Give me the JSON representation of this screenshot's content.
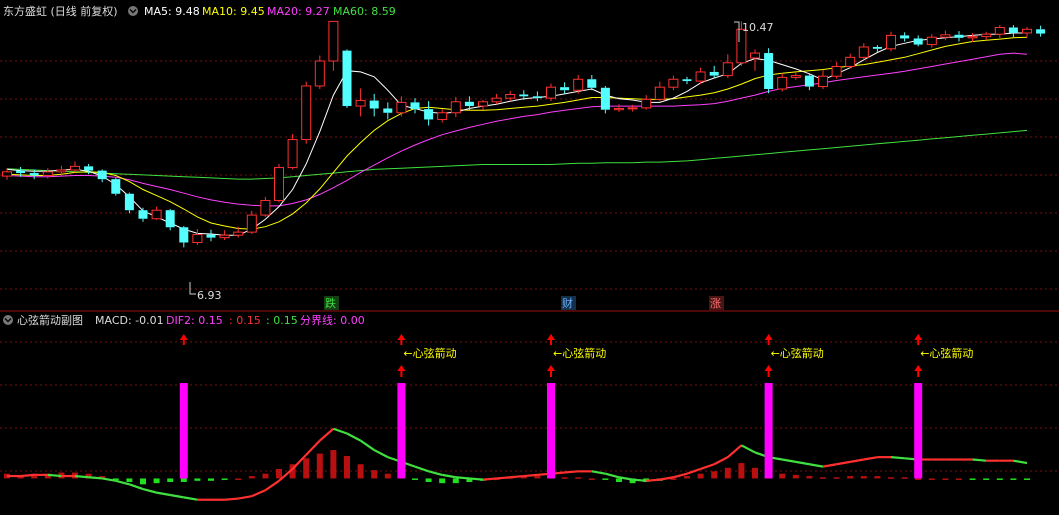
{
  "main_panel": {
    "title": "东方盛虹 (日线 前复权)",
    "ma_labels": [
      {
        "text": "MA5: 9.48",
        "color": "#ffffff"
      },
      {
        "text": "MA10: 9.45",
        "color": "#ffff00"
      },
      {
        "text": "MA20: 9.27",
        "color": "#ff40ff"
      },
      {
        "text": "MA60: 8.59",
        "color": "#40e040"
      }
    ],
    "high_label": "10.47",
    "low_label": "6.93",
    "event_tags": [
      {
        "text": "跌",
        "color": "#40e040",
        "bg": "#154015"
      },
      {
        "text": "财",
        "color": "#6ab0ff",
        "bg": "#15304a"
      },
      {
        "text": "涨",
        "color": "#ff7070",
        "bg": "#4a1515"
      }
    ]
  },
  "sub_panel": {
    "title": "心弦箭动副图",
    "labels": [
      {
        "text": "MACD: -0.01",
        "color": "#dddddd"
      },
      {
        "text": "DIF2: 0.15",
        "color": "#ff40ff"
      },
      {
        "text": ": 0.15",
        "color": "#ff3030"
      },
      {
        "text": ": 0.15",
        "color": "#40e040"
      },
      {
        "text": "分界线: 0.00",
        "color": "#ff40ff"
      }
    ],
    "signal_text": "←心弦箭动"
  },
  "colors": {
    "up": "#ff3030",
    "down": "#54ffff",
    "ma5": "#ffffff",
    "ma10": "#ffff00",
    "ma20": "#ff40ff",
    "ma60": "#40e040",
    "signal_bar": "#ff00ff",
    "arrow": "#ff0000",
    "signal_text": "#ffff00",
    "grid": "#7a1010"
  },
  "chart_data": {
    "type": "candlestick",
    "y_range": [
      6.4,
      10.8
    ],
    "candles": [
      [
        8.27,
        8.34,
        8.4,
        8.21
      ],
      [
        8.36,
        8.32,
        8.42,
        8.26
      ],
      [
        8.32,
        8.28,
        8.38,
        8.22
      ],
      [
        8.28,
        8.34,
        8.4,
        8.23
      ],
      [
        8.34,
        8.37,
        8.44,
        8.28
      ],
      [
        8.37,
        8.43,
        8.51,
        8.33
      ],
      [
        8.43,
        8.36,
        8.47,
        8.3
      ],
      [
        8.36,
        8.22,
        8.38,
        8.17
      ],
      [
        8.22,
        7.98,
        8.24,
        7.95
      ],
      [
        7.98,
        7.71,
        8.0,
        7.66
      ],
      [
        7.71,
        7.57,
        7.75,
        7.52
      ],
      [
        7.57,
        7.71,
        7.77,
        7.55
      ],
      [
        7.71,
        7.43,
        7.73,
        7.38
      ],
      [
        7.43,
        7.18,
        7.45,
        7.1
      ],
      [
        7.18,
        7.31,
        7.4,
        7.14
      ],
      [
        7.31,
        7.26,
        7.39,
        7.2
      ],
      [
        7.26,
        7.3,
        7.38,
        7.22
      ],
      [
        7.3,
        7.35,
        7.44,
        7.26
      ],
      [
        7.35,
        7.63,
        7.7,
        7.32
      ],
      [
        7.63,
        7.87,
        7.93,
        7.6
      ],
      [
        7.87,
        8.41,
        8.47,
        7.84
      ],
      [
        8.41,
        8.87,
        8.96,
        8.38
      ],
      [
        8.87,
        9.75,
        9.82,
        8.8
      ],
      [
        9.75,
        10.16,
        10.25,
        9.7
      ],
      [
        10.16,
        10.81,
        10.81,
        10.0
      ],
      [
        10.33,
        9.42,
        10.35,
        9.39
      ],
      [
        9.42,
        9.51,
        9.71,
        9.25
      ],
      [
        9.51,
        9.38,
        9.62,
        9.25
      ],
      [
        9.38,
        9.31,
        9.48,
        9.2
      ],
      [
        9.31,
        9.48,
        9.58,
        9.25
      ],
      [
        9.48,
        9.37,
        9.55,
        9.3
      ],
      [
        9.37,
        9.2,
        9.5,
        9.1
      ],
      [
        9.2,
        9.31,
        9.37,
        9.15
      ],
      [
        9.31,
        9.49,
        9.57,
        9.24
      ],
      [
        9.49,
        9.42,
        9.58,
        9.35
      ],
      [
        9.42,
        9.49,
        9.52,
        9.36
      ],
      [
        9.49,
        9.55,
        9.62,
        9.45
      ],
      [
        9.55,
        9.61,
        9.67,
        9.5
      ],
      [
        9.61,
        9.58,
        9.68,
        9.52
      ],
      [
        9.58,
        9.55,
        9.66,
        9.5
      ],
      [
        9.55,
        9.73,
        9.79,
        9.5
      ],
      [
        9.73,
        9.68,
        9.81,
        9.62
      ],
      [
        9.68,
        9.86,
        9.93,
        9.62
      ],
      [
        9.86,
        9.72,
        9.93,
        9.68
      ],
      [
        9.72,
        9.36,
        9.75,
        9.3
      ],
      [
        9.36,
        9.38,
        9.45,
        9.32
      ],
      [
        9.38,
        9.39,
        9.44,
        9.33
      ],
      [
        9.39,
        9.53,
        9.6,
        9.36
      ],
      [
        9.53,
        9.73,
        9.82,
        9.5
      ],
      [
        9.73,
        9.86,
        9.92,
        9.68
      ],
      [
        9.86,
        9.83,
        9.9,
        9.78
      ],
      [
        9.83,
        9.98,
        10.05,
        9.78
      ],
      [
        9.98,
        9.92,
        10.08,
        9.88
      ],
      [
        9.92,
        10.13,
        10.27,
        9.88
      ],
      [
        10.13,
        10.68,
        10.81,
        10.08
      ],
      [
        10.21,
        10.29,
        10.35,
        10.0
      ],
      [
        10.29,
        9.7,
        10.37,
        9.63
      ],
      [
        9.7,
        9.89,
        9.96,
        9.66
      ],
      [
        9.89,
        9.92,
        9.98,
        9.85
      ],
      [
        9.92,
        9.74,
        9.96,
        9.68
      ],
      [
        9.74,
        9.91,
        10.01,
        9.7
      ],
      [
        9.91,
        10.07,
        10.14,
        9.87
      ],
      [
        10.07,
        10.22,
        10.28,
        10.04
      ],
      [
        10.22,
        10.39,
        10.45,
        10.18
      ],
      [
        10.39,
        10.36,
        10.42,
        10.3
      ],
      [
        10.36,
        10.58,
        10.64,
        10.32
      ],
      [
        10.58,
        10.53,
        10.63,
        10.48
      ],
      [
        10.53,
        10.43,
        10.58,
        10.4
      ],
      [
        10.43,
        10.55,
        10.6,
        10.38
      ],
      [
        10.55,
        10.59,
        10.66,
        10.5
      ],
      [
        10.59,
        10.54,
        10.65,
        10.48
      ],
      [
        10.54,
        10.56,
        10.62,
        10.47
      ],
      [
        10.56,
        10.6,
        10.64,
        10.5
      ],
      [
        10.6,
        10.71,
        10.75,
        10.54
      ],
      [
        10.71,
        10.62,
        10.75,
        10.55
      ],
      [
        10.62,
        10.68,
        10.72,
        10.55
      ],
      [
        10.68,
        10.61,
        10.74,
        10.56
      ]
    ],
    "ma5": [
      8.38,
      8.36,
      8.35,
      8.35,
      8.37,
      8.38,
      8.35,
      8.27,
      8.13,
      7.93,
      7.7,
      7.6,
      7.5,
      7.4,
      7.33,
      7.32,
      7.3,
      7.3,
      7.4,
      7.56,
      7.77,
      8.05,
      8.47,
      9.0,
      9.6,
      10.0,
      9.98,
      9.9,
      9.68,
      9.43,
      9.38,
      9.32,
      9.3,
      9.32,
      9.38,
      9.42,
      9.45,
      9.5,
      9.54,
      9.56,
      9.58,
      9.62,
      9.66,
      9.7,
      9.6,
      9.54,
      9.52,
      9.48,
      9.48,
      9.55,
      9.66,
      9.8,
      9.88,
      9.95,
      10.12,
      10.2,
      10.17,
      10.1,
      10.03,
      9.95,
      9.85,
      9.95,
      10.05,
      10.18,
      10.3,
      10.4,
      10.45,
      10.5,
      10.52,
      10.54,
      10.56,
      10.58,
      10.6,
      10.6,
      10.62,
      10.62
    ],
    "ma10": [
      8.3,
      8.29,
      8.28,
      8.28,
      8.3,
      8.33,
      8.34,
      8.33,
      8.28,
      8.18,
      8.05,
      7.95,
      7.85,
      7.73,
      7.6,
      7.5,
      7.45,
      7.41,
      7.4,
      7.44,
      7.52,
      7.65,
      7.83,
      8.06,
      8.33,
      8.6,
      8.82,
      9.02,
      9.18,
      9.3,
      9.38,
      9.4,
      9.38,
      9.36,
      9.35,
      9.35,
      9.36,
      9.38,
      9.4,
      9.42,
      9.45,
      9.48,
      9.52,
      9.56,
      9.56,
      9.55,
      9.54,
      9.53,
      9.53,
      9.54,
      9.57,
      9.6,
      9.64,
      9.7,
      9.78,
      9.87,
      9.93,
      9.96,
      9.98,
      10.0,
      10.02,
      10.05,
      10.08,
      10.1,
      10.14,
      10.18,
      10.22,
      10.28,
      10.34,
      10.4,
      10.44,
      10.48,
      10.5,
      10.52,
      10.54,
      10.55
    ],
    "ma20": [
      8.28,
      8.27,
      8.26,
      8.26,
      8.27,
      8.28,
      8.28,
      8.27,
      8.25,
      8.21,
      8.15,
      8.1,
      8.05,
      7.99,
      7.93,
      7.88,
      7.84,
      7.81,
      7.79,
      7.78,
      7.78,
      7.82,
      7.88,
      7.97,
      8.08,
      8.2,
      8.33,
      8.45,
      8.57,
      8.68,
      8.78,
      8.87,
      8.95,
      9.01,
      9.07,
      9.12,
      9.17,
      9.21,
      9.25,
      9.28,
      9.32,
      9.35,
      9.38,
      9.41,
      9.42,
      9.42,
      9.42,
      9.42,
      9.42,
      9.42,
      9.43,
      9.44,
      9.46,
      9.5,
      9.55,
      9.6,
      9.66,
      9.71,
      9.74,
      9.77,
      9.8,
      9.84,
      9.87,
      9.9,
      9.93,
      9.96,
      9.99,
      10.03,
      10.07,
      10.11,
      10.15,
      10.19,
      10.23,
      10.27,
      10.29,
      10.27
    ],
    "ma60": [
      8.39,
      8.38,
      8.37,
      8.36,
      8.35,
      8.34,
      8.33,
      8.32,
      8.31,
      8.3,
      8.29,
      8.28,
      8.27,
      8.26,
      8.25,
      8.24,
      8.23,
      8.22,
      8.22,
      8.23,
      8.24,
      8.26,
      8.28,
      8.3,
      8.32,
      8.34,
      8.36,
      8.38,
      8.39,
      8.4,
      8.41,
      8.42,
      8.43,
      8.44,
      8.45,
      8.46,
      8.46,
      8.46,
      8.46,
      8.46,
      8.46,
      8.47,
      8.48,
      8.48,
      8.49,
      8.49,
      8.49,
      8.5,
      8.5,
      8.51,
      8.52,
      8.54,
      8.56,
      8.58,
      8.6,
      8.62,
      8.64,
      8.66,
      8.68,
      8.7,
      8.72,
      8.74,
      8.76,
      8.78,
      8.8,
      8.82,
      8.84,
      8.86,
      8.88,
      8.9,
      8.92,
      8.94,
      8.96,
      8.98,
      9.0,
      9.02
    ],
    "dif": [
      0.02,
      0.02,
      0.03,
      0.03,
      0.02,
      0.02,
      0.01,
      0.0,
      -0.02,
      -0.05,
      -0.09,
      -0.12,
      -0.14,
      -0.16,
      -0.18,
      -0.18,
      -0.18,
      -0.17,
      -0.15,
      -0.1,
      -0.02,
      0.08,
      0.2,
      0.32,
      0.42,
      0.38,
      0.32,
      0.24,
      0.18,
      0.14,
      0.1,
      0.06,
      0.03,
      0.01,
      0.0,
      -0.01,
      0.0,
      0.01,
      0.02,
      0.03,
      0.04,
      0.05,
      0.06,
      0.06,
      0.04,
      0.01,
      -0.01,
      -0.02,
      -0.01,
      0.01,
      0.04,
      0.08,
      0.12,
      0.18,
      0.28,
      0.22,
      0.18,
      0.16,
      0.14,
      0.12,
      0.1,
      0.12,
      0.14,
      0.16,
      0.18,
      0.18,
      0.17,
      0.16,
      0.16,
      0.16,
      0.16,
      0.16,
      0.15,
      0.15,
      0.15,
      0.13
    ],
    "macd_bars": [
      0.04,
      0.03,
      0.04,
      0.04,
      0.05,
      0.05,
      0.04,
      0.02,
      -0.01,
      -0.03,
      -0.05,
      -0.04,
      -0.03,
      -0.03,
      -0.02,
      -0.02,
      -0.01,
      0.0,
      0.02,
      0.04,
      0.08,
      0.12,
      0.17,
      0.21,
      0.24,
      0.19,
      0.12,
      0.07,
      0.04,
      0.02,
      -0.01,
      -0.03,
      -0.04,
      -0.04,
      -0.03,
      -0.02,
      0.0,
      0.01,
      0.02,
      0.02,
      0.02,
      0.01,
      0.01,
      0.0,
      -0.01,
      -0.03,
      -0.04,
      -0.03,
      -0.02,
      0.0,
      0.02,
      0.04,
      0.06,
      0.09,
      0.13,
      0.09,
      0.06,
      0.04,
      0.03,
      0.02,
      0.01,
      0.01,
      0.02,
      0.02,
      0.02,
      0.01,
      0.01,
      0.0,
      0.0,
      0.0,
      0.0,
      -0.01,
      -0.01,
      -0.01,
      -0.01,
      -0.01
    ],
    "sub_y_range": [
      -0.25,
      0.9
    ],
    "signal_indices": [
      13,
      29,
      40,
      56,
      67
    ]
  }
}
